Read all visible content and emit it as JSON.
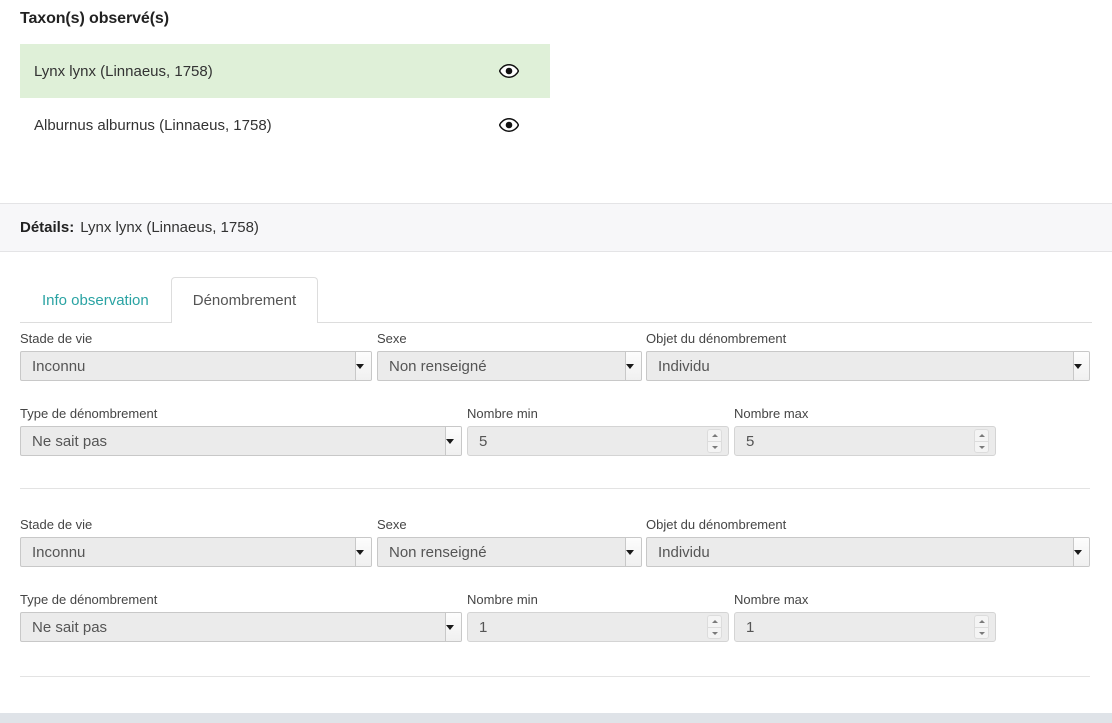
{
  "taxon_section": {
    "title": "Taxon(s) observé(s)",
    "items": [
      {
        "name": "Lynx lynx (Linnaeus, 1758)",
        "selected": true,
        "eye_icon": "eye-icon"
      },
      {
        "name": "Alburnus alburnus (Linnaeus, 1758)",
        "selected": false,
        "eye_icon": "eye-icon"
      }
    ],
    "selected_color": "#dff0d8"
  },
  "details": {
    "label": "Détails:",
    "taxon": "Lynx lynx (Linnaeus, 1758)"
  },
  "tabs": [
    {
      "label": "Info observation",
      "active": false
    },
    {
      "label": "Dénombrement",
      "active": true
    }
  ],
  "tab_accent_color": "#2aa3a3",
  "labels": {
    "stade_de_vie": "Stade de vie",
    "sexe": "Sexe",
    "objet": "Objet du dénombrement",
    "type": "Type de dénombrement",
    "nombre_min": "Nombre min",
    "nombre_max": "Nombre max"
  },
  "counts": [
    {
      "stade_de_vie": "Inconnu",
      "sexe": "Non renseigné",
      "objet": "Individu",
      "type": "Ne sait pas",
      "nombre_min": "5",
      "nombre_max": "5"
    },
    {
      "stade_de_vie": "Inconnu",
      "sexe": "Non renseigné",
      "objet": "Individu",
      "type": "Ne sait pas",
      "nombre_min": "1",
      "nombre_max": "1"
    }
  ]
}
